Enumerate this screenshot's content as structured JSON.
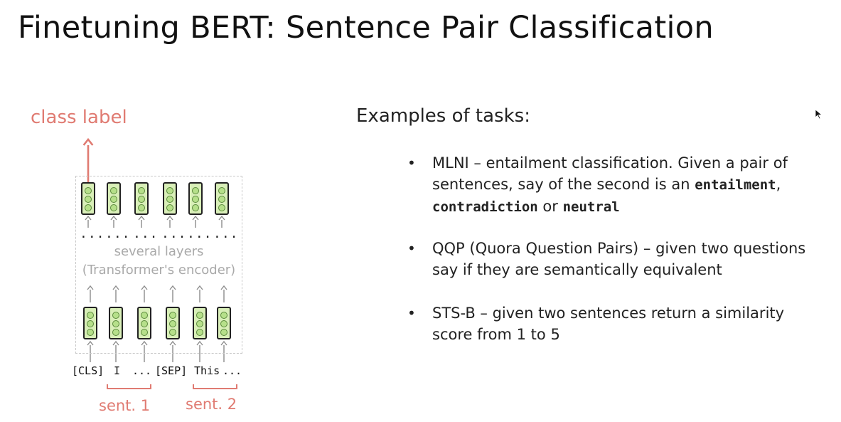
{
  "title": "Finetuning BERT: Sentence Pair Classification",
  "diagram": {
    "output_label": "class label",
    "ellipsis": "...",
    "middle_line1": "several layers",
    "middle_line2": "(Transformer's encoder)",
    "tokens": [
      "[CLS]",
      "I",
      "...",
      "[SEP]",
      "This",
      "..."
    ],
    "bracket_labels": [
      "sent. 1",
      "sent. 2"
    ],
    "colors": {
      "accent": "#e07b72",
      "cell_fill": "#d9efb8",
      "dot_fill": "#b6e08a",
      "arrow": "#8c8c8c"
    }
  },
  "examples": {
    "heading": "Examples of tasks:",
    "bullet_symbol": "•",
    "items": [
      {
        "name": "MLNI",
        "text_a": " – entailment classification. Given a pair of sentences, say of the second is an ",
        "term1": "entailment",
        "sep1": ", ",
        "term2": "contradiction",
        "sep2": " or ",
        "term3": "neutral"
      },
      {
        "name": "QQP (Quora Question Pairs)",
        "text": " – given two questions say if they are semantically equivalent"
      },
      {
        "name": "STS-B",
        "text": " – given two sentences return a similarity score from 1 to 5"
      }
    ]
  }
}
